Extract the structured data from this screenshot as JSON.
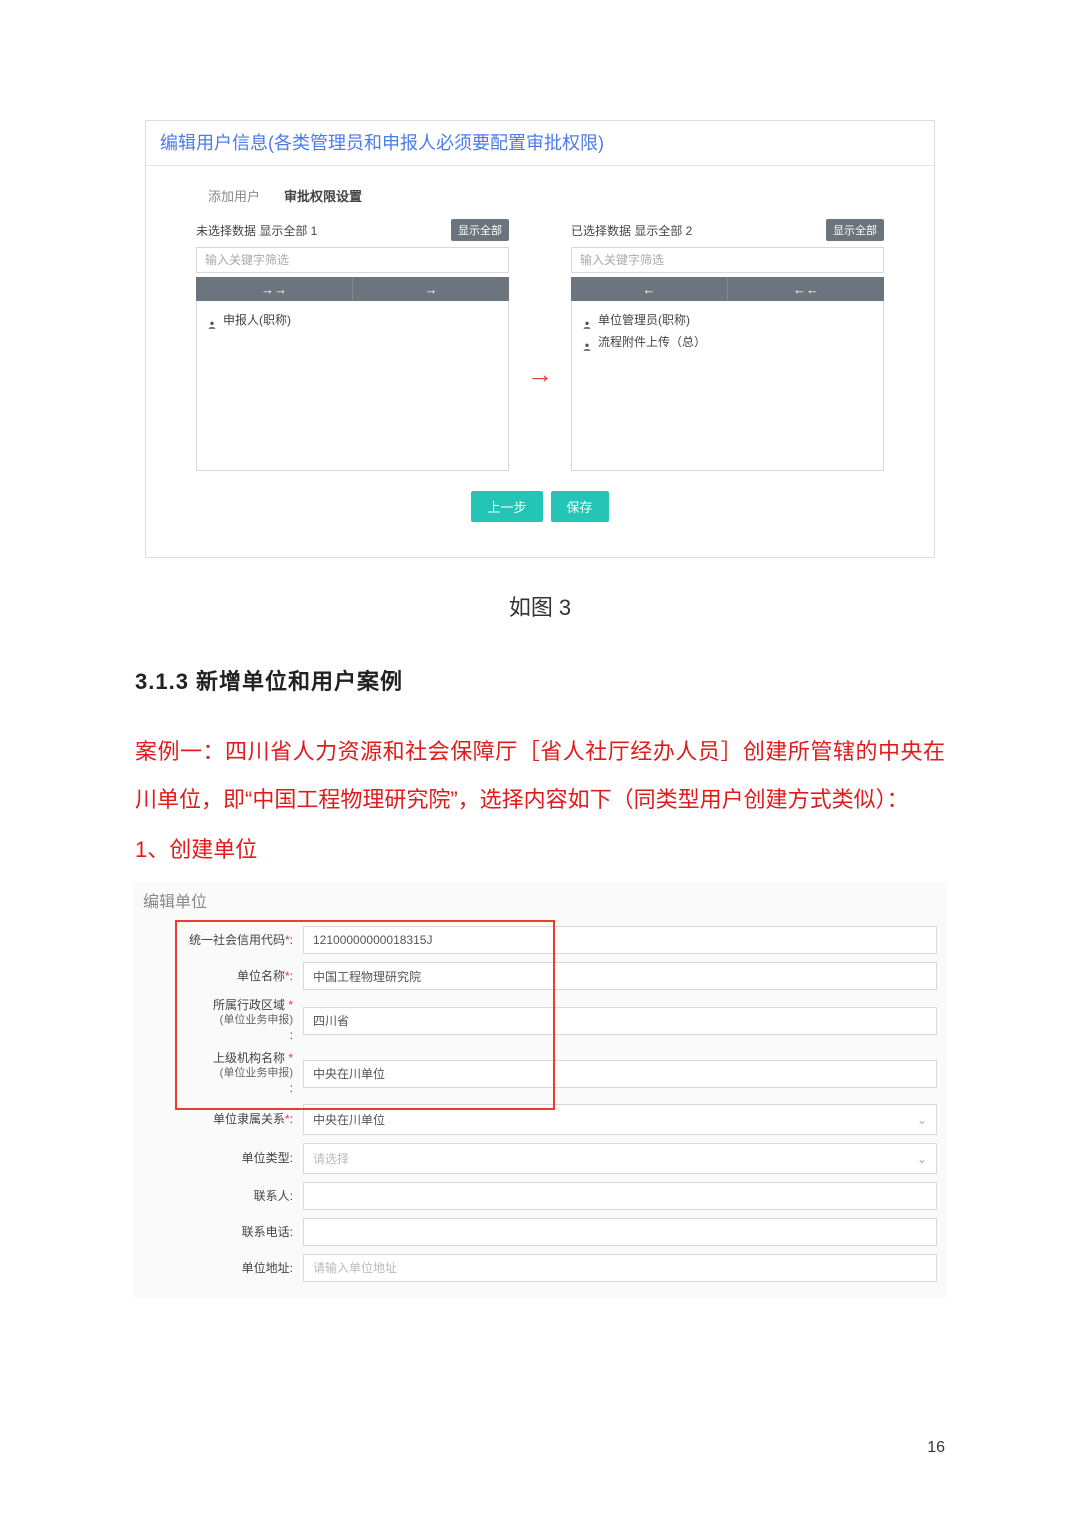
{
  "dialog": {
    "title": "编辑用户信息(各类管理员和申报人必须要配置审批权限)",
    "tabs": {
      "add": "添加用户",
      "perm": "审批权限设置"
    },
    "left": {
      "header": "未选择数据 显示全部 1",
      "showAll": "显示全部",
      "placeholder": "输入关键字筛选",
      "items": [
        "申报人(职称)"
      ]
    },
    "right": {
      "header": "已选择数据 显示全部 2",
      "showAll": "显示全部",
      "placeholder": "输入关键字筛选",
      "items": [
        "单位管理员(职称)",
        "流程附件上传（总）"
      ]
    },
    "arrows": {
      "dblRight": "→→",
      "singleRight": "→",
      "singleLeft": "←",
      "dblLeft": "←←"
    },
    "actions": {
      "prev": "上一步",
      "save": "保存"
    },
    "centerArrow": "→"
  },
  "caption1": "如图 3",
  "heading": "3.1.3 新增单位和用户案例",
  "paraRed": "案例一：四川省人力资源和社会保障厅［省人社厅经办人员］创建所管辖的中央在川单位，即“中国工程物理研究院”，选择内容如下（同类型用户创建方式类似）：",
  "subHead": "1、创建单位",
  "form": {
    "title": "编辑单位",
    "rows": {
      "code": {
        "label": "统一社会信用代码",
        "req": true,
        "value": "12100000000018315J"
      },
      "name": {
        "label": "单位名称",
        "req": true,
        "value": "中国工程物理研究院"
      },
      "region": {
        "label": "所属行政区域",
        "req": true,
        "sub": "(单位业务申报)",
        "value": "四川省"
      },
      "parent": {
        "label": "上级机构名称",
        "req": true,
        "sub": "(单位业务申报)",
        "value": "中央在川单位"
      },
      "affil": {
        "label": "单位隶属关系",
        "req": true,
        "value": "中央在川单位",
        "select": true
      },
      "type": {
        "label": "单位类型",
        "req": false,
        "value": "请选择",
        "placeholder": true,
        "select": true
      },
      "contact": {
        "label": "联系人",
        "req": false,
        "value": ""
      },
      "phone": {
        "label": "联系电话",
        "req": false,
        "value": ""
      },
      "addr": {
        "label": "单位地址",
        "req": false,
        "value": "",
        "ph": "请输入单位地址"
      }
    }
  },
  "pageNum": "16"
}
